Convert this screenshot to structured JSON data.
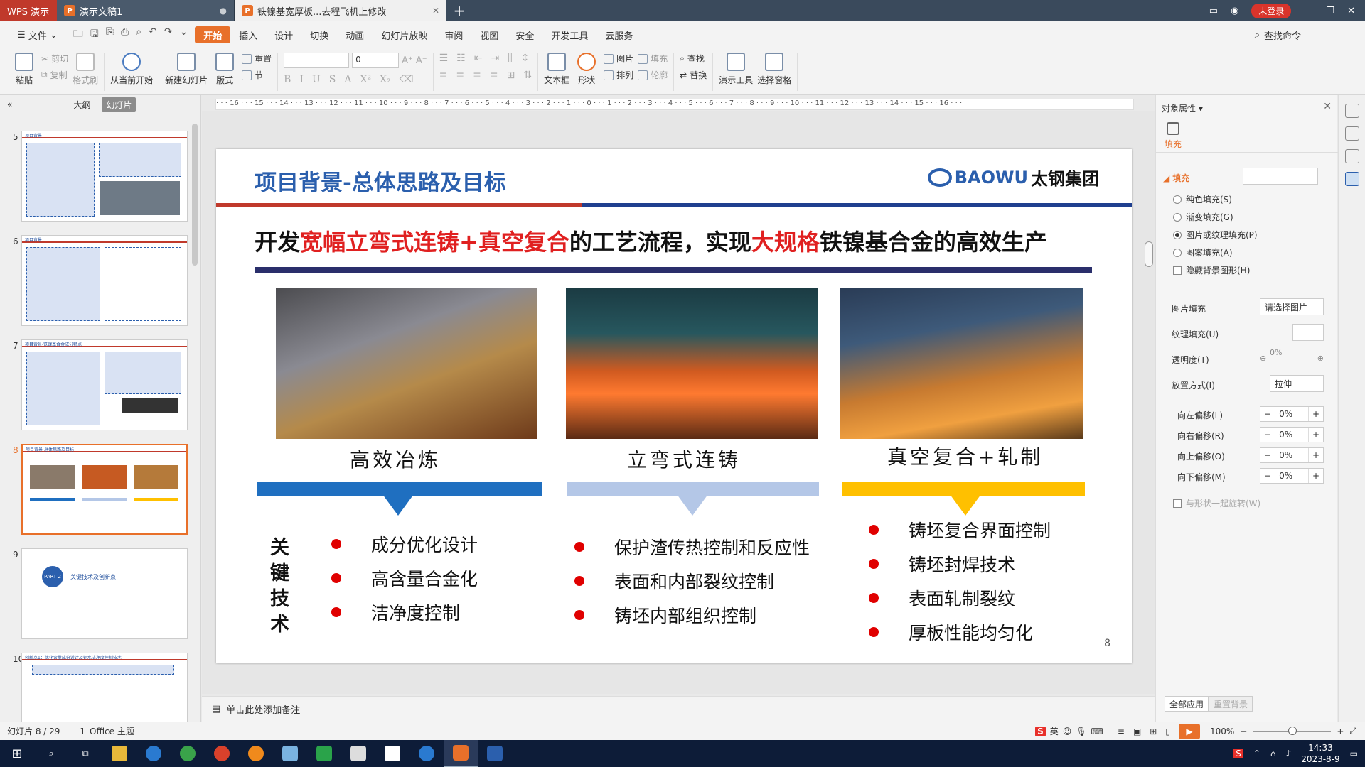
{
  "titlebar": {
    "app_tab": "WPS 演示",
    "doc_tab": "演示文稿1",
    "active_tab": "铁镍基宽厚板...去程飞机上修改",
    "login": "未登录"
  },
  "menu": {
    "file": "文件",
    "items": [
      "开始",
      "插入",
      "设计",
      "切换",
      "动画",
      "幻灯片放映",
      "审阅",
      "视图",
      "安全",
      "开发工具",
      "云服务"
    ],
    "search": "查找命令"
  },
  "ribbon": {
    "paste": "粘贴",
    "cut": "剪切",
    "copy": "复制",
    "format_painter": "格式刷",
    "from_current": "从当前开始",
    "new_slide": "新建幻灯片",
    "layout": "版式",
    "reset": "重置",
    "section": "节",
    "font_name": "",
    "font_size": "0",
    "textbox": "文本框",
    "shape": "形状",
    "picture": "图片",
    "arrange": "排列",
    "fill": "填充",
    "outline": "轮廓",
    "find": "查找",
    "replace": "替换",
    "present_tools": "演示工具",
    "select_pane": "选择窗格"
  },
  "leftpanel": {
    "tab_outline": "大纲",
    "tab_slides": "幻灯片",
    "slides": [
      {
        "num": "5",
        "title": "项目背景"
      },
      {
        "num": "6",
        "title": "项目背景"
      },
      {
        "num": "7",
        "title": "项目背景-铁镍基合金成分特点"
      },
      {
        "num": "8",
        "title": "项目背景-总体思路及目标"
      },
      {
        "num": "9",
        "title": "关键技术及创新点",
        "part": "PART 2"
      },
      {
        "num": "10",
        "title": "创新点1：优化含量成分设计及钢水洁净度控制技术"
      }
    ]
  },
  "ruler": "· · · 16 · · · 15 · · · 14 · · · 13 · · · 12 · · · 11 · · · 10 · · · 9 · · · 8 · · · 7 · · · 6 · · · 5 · · · 4 · · · 3 · · · 2 · · · 1 · · · 0 · · · 1 · · · 2 · · · 3 · · · 4 · · · 5 · · · 6 · · · 7 · · · 8 · · · 9 · · · 10 · · · 11 · · · 12 · · · 13 · · · 14 · · · 15 · · · 16 · · ·",
  "slide": {
    "title": "项目背景-总体思路及目标",
    "logo_en": "BAOWU",
    "logo_cn": "太钢集团",
    "headline_parts": [
      "开发",
      "宽幅立弯式连铸+真空复合",
      "的工艺流程，实现",
      "大规格",
      "铁镍基合金的高效生产"
    ],
    "categories": [
      "高效冶炼",
      "立弯式连铸",
      "真空复合+轧制"
    ],
    "key_tech": [
      "关",
      "键",
      "技",
      "术"
    ],
    "col1": [
      "成分优化设计",
      "高含量合金化",
      "洁净度控制"
    ],
    "col2": [
      "保护渣传热控制和反应性",
      "表面和内部裂纹控制",
      "铸坯内部组织控制"
    ],
    "col3": [
      "铸坯复合界面控制",
      "铸坯封焊技术",
      "表面轧制裂纹",
      "厚板性能均匀化"
    ],
    "page_number": "8",
    "colors": {
      "title_blue": "#2b5fad",
      "accent_red": "#e02020",
      "band_blue": "#1f6fc0",
      "band_light": "#b4c7e7",
      "band_yellow": "#ffc000"
    }
  },
  "notes": "单击此处添加备注",
  "rightpanel": {
    "header": "对象属性",
    "fill_tab": "填充",
    "section": "填充",
    "options": [
      "纯色填充(S)",
      "渐变填充(G)",
      "图片或纹理填充(P)",
      "图案填充(A)"
    ],
    "selected_option": "图片或纹理填充(P)",
    "hide_bg": "隐藏背景图形(H)",
    "picture_fill_label": "图片填充",
    "picture_fill_value": "请选择图片",
    "texture_fill_label": "纹理填充(U)",
    "transparency_label": "透明度(T)",
    "transparency_value": "0%",
    "placement_label": "放置方式(I)",
    "placement_value": "拉伸",
    "offsets": [
      {
        "label": "向左偏移(L)",
        "value": "0%"
      },
      {
        "label": "向右偏移(R)",
        "value": "0%"
      },
      {
        "label": "向上偏移(O)",
        "value": "0%"
      },
      {
        "label": "向下偏移(M)",
        "value": "0%"
      }
    ],
    "rotate_with_shape": "与形状一起旋转(W)",
    "apply_all": "全部应用",
    "reset_bg": "重置背景"
  },
  "status": {
    "slide_info": "幻灯片 8 / 29",
    "theme": "1_Office 主题",
    "ime": "英",
    "zoom": "100%"
  },
  "taskbar": {
    "time": "14:33",
    "date": "2023-8-9"
  }
}
